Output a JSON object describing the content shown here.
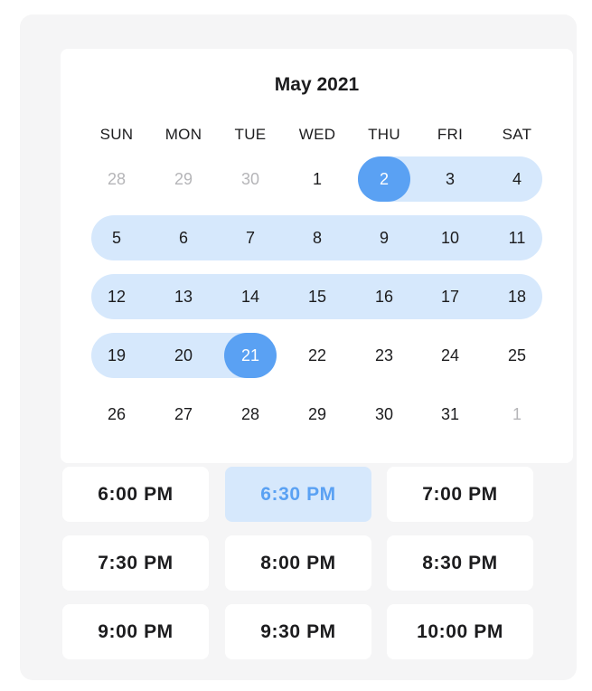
{
  "calendar": {
    "month_title": "May 2021",
    "weekdays": [
      "SUN",
      "MON",
      "TUE",
      "WED",
      "THU",
      "FRI",
      "SAT"
    ],
    "weeks": [
      [
        "28",
        "29",
        "30",
        "1",
        "2",
        "3",
        "4"
      ],
      [
        "5",
        "6",
        "7",
        "8",
        "9",
        "10",
        "11"
      ],
      [
        "12",
        "13",
        "14",
        "15",
        "16",
        "17",
        "18"
      ],
      [
        "19",
        "20",
        "21",
        "22",
        "23",
        "24",
        "25"
      ],
      [
        "26",
        "27",
        "28",
        "29",
        "30",
        "31",
        "1"
      ]
    ],
    "range_start": "2",
    "range_end": "21"
  },
  "time_slots": {
    "slots": [
      "6:00 PM",
      "6:30 PM",
      "7:00 PM",
      "7:30 PM",
      "8:00 PM",
      "8:30 PM",
      "9:00 PM",
      "9:30 PM",
      "10:00 PM"
    ],
    "selected": "6:30 PM"
  },
  "colors": {
    "accent": "#5aa1f3",
    "range_fill": "#d6e8fc",
    "panel_bg": "#f5f5f6",
    "muted_text": "#b5b5b8"
  }
}
